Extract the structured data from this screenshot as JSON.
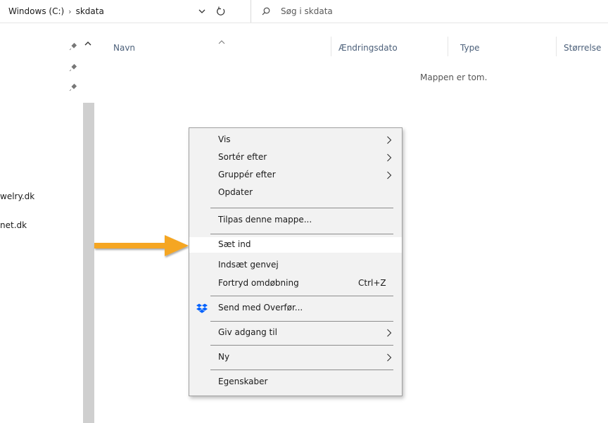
{
  "address": {
    "root": "Windows (C:)",
    "separator": "›",
    "current": "skdata"
  },
  "search": {
    "placeholder": "Søg i skdata"
  },
  "nav": {
    "items": [
      {
        "label": "welry.dk"
      },
      {
        "label": "net.dk"
      }
    ]
  },
  "columns": {
    "name": "Navn",
    "date": "Ændringsdato",
    "type": "Type",
    "size": "Størrelse"
  },
  "content": {
    "empty": "Mappen er tom."
  },
  "context_menu": {
    "items": [
      {
        "label": "Vis",
        "submenu": true
      },
      {
        "label": "Sortér efter",
        "submenu": true
      },
      {
        "label": "Gruppér efter",
        "submenu": true
      },
      {
        "label": "Opdater"
      },
      {
        "label": "Tilpas denne mappe..."
      },
      {
        "label": "Sæt ind",
        "highlighted": true
      },
      {
        "label": "Indsæt genvej"
      },
      {
        "label": "Fortryd omdøbning",
        "shortcut": "Ctrl+Z"
      },
      {
        "label": "Send med Overfør...",
        "icon": "dropbox-icon"
      },
      {
        "label": "Giv adgang til",
        "submenu": true
      },
      {
        "label": "Ny",
        "submenu": true
      },
      {
        "label": "Egenskaber"
      }
    ]
  },
  "colors": {
    "arrow": "#f5a623",
    "menu_bg": "#f2f2f2",
    "highlight_bg": "#ffffff",
    "header_text": "#4c607a",
    "dropbox": "#0061fe"
  }
}
